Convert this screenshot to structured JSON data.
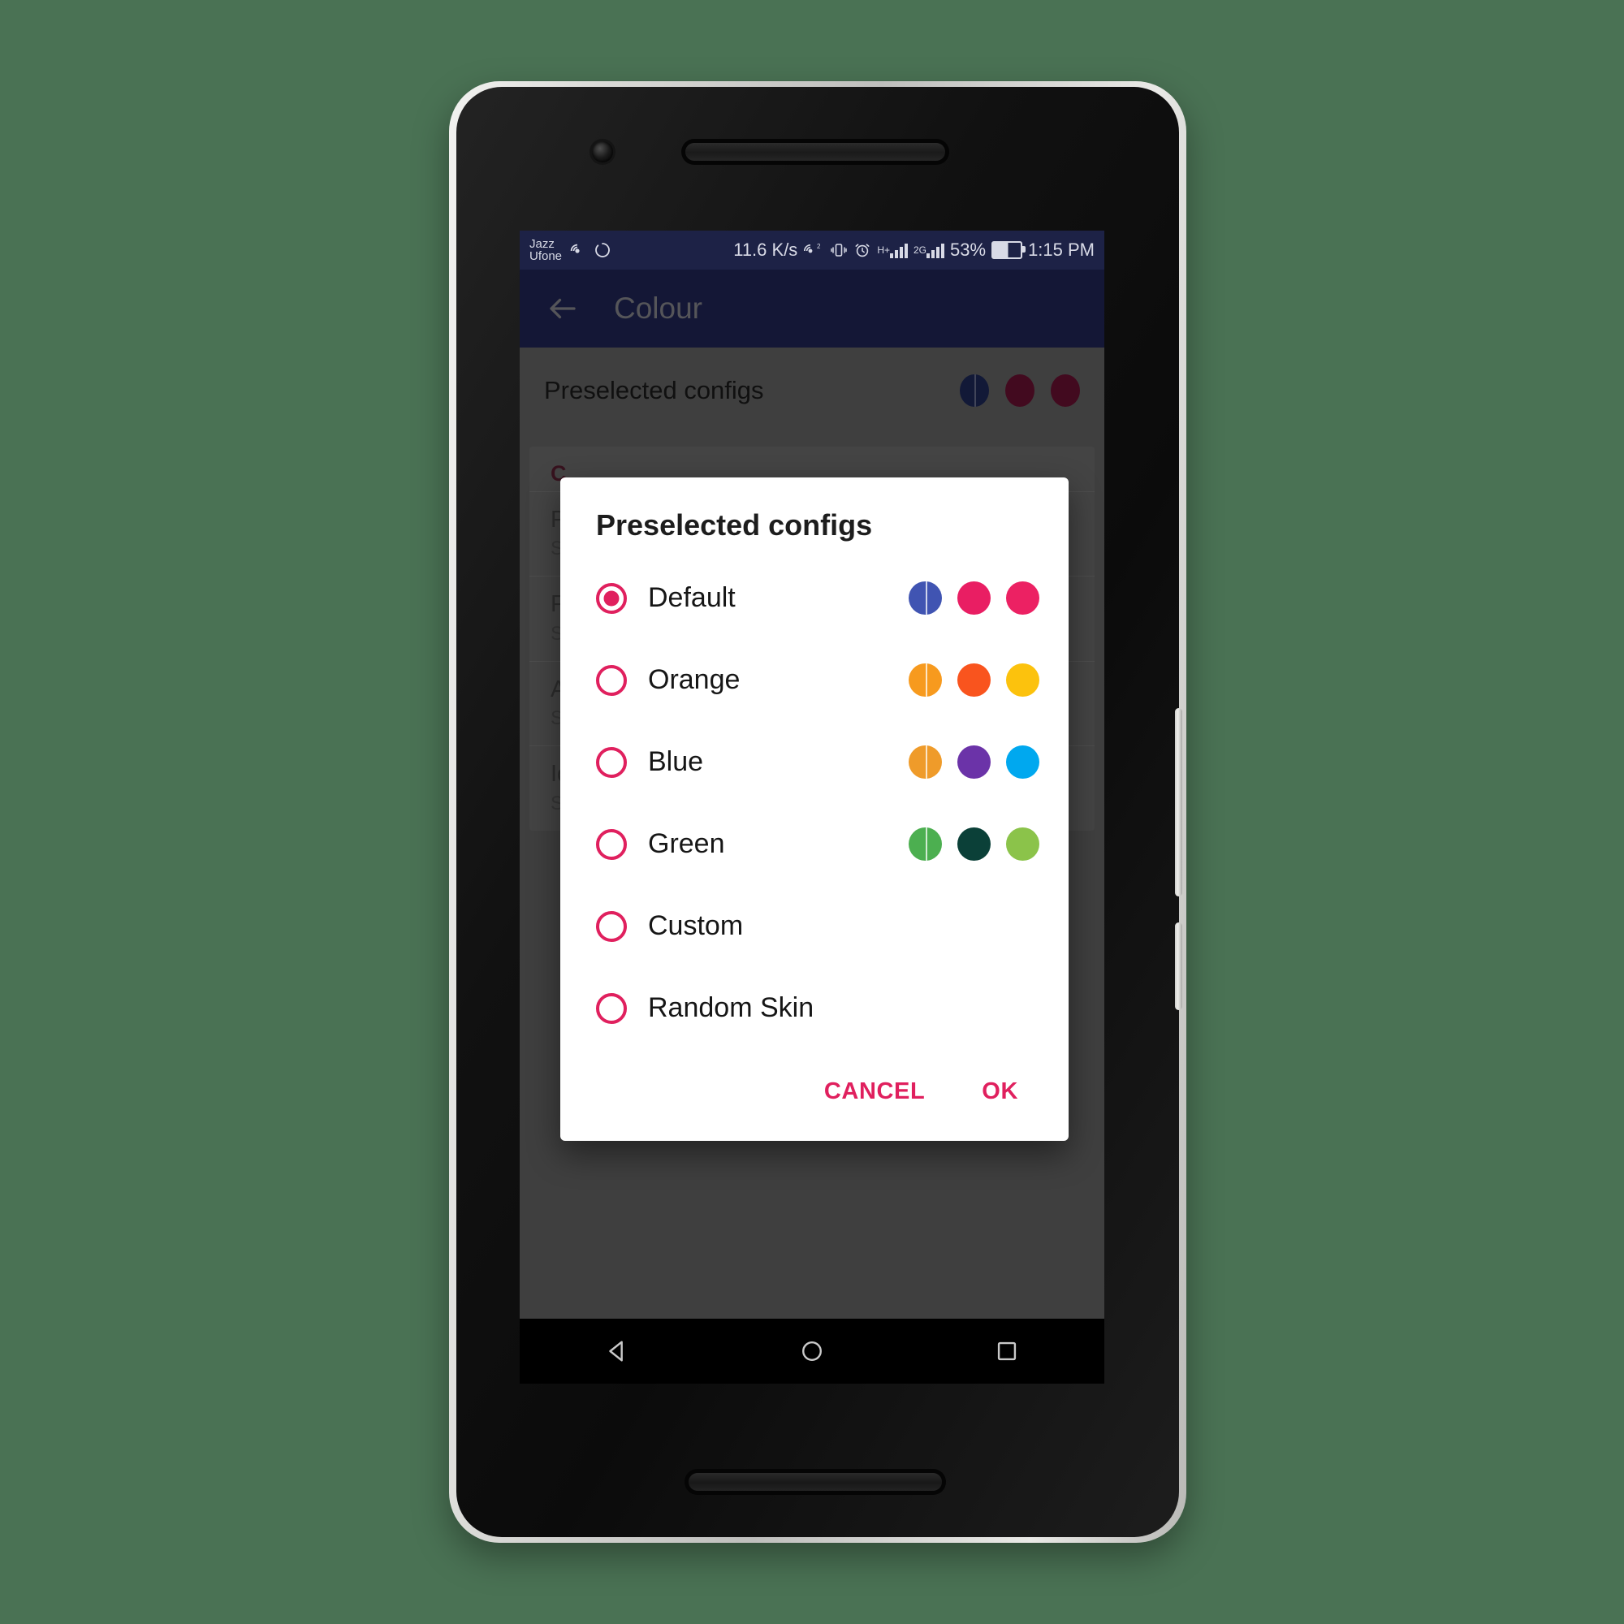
{
  "device": {
    "label": "android-phone",
    "body_color": "#d9d9d6",
    "bezel_color": "#111111"
  },
  "statusbar": {
    "carrier_line1": "Jazz",
    "carrier_line2": "Ufone",
    "net_speed": "11.6 K/s",
    "data_sup": "2",
    "network_1": "H+",
    "network_2": "2G",
    "battery_percent": "53%",
    "clock": "1:15 PM",
    "bg": "#1d2246",
    "fg": "#d8dae6"
  },
  "appbar": {
    "title": "Colour",
    "back_icon": "back-arrow-icon",
    "bg": "#22275a",
    "title_color": "#8e8e94"
  },
  "content": {
    "preselect_row": {
      "label": "Preselected configs",
      "dots": [
        "#1f2a5c",
        "#6e1134",
        "#6e1134"
      ]
    },
    "card_header": "C",
    "list_items": [
      {
        "title": "P",
        "subtitle": "S"
      },
      {
        "title": "P",
        "subtitle": "S"
      },
      {
        "title": "A",
        "subtitle": "S"
      },
      {
        "title": "Id",
        "subtitle": "S"
      }
    ]
  },
  "dialog": {
    "title": "Preselected configs",
    "accent": "#e0205e",
    "options": [
      {
        "label": "Default",
        "selected": true,
        "swatches": [
          "#4054b2",
          "#e91e63",
          "#ec2163"
        ]
      },
      {
        "label": "Orange",
        "selected": false,
        "swatches": [
          "#f79a1e",
          "#f9541e",
          "#fcc20d"
        ]
      },
      {
        "label": "Blue",
        "selected": false,
        "swatches": [
          "#ef9b2a",
          "#6b33a8",
          "#00a8ef"
        ]
      },
      {
        "label": "Green",
        "selected": false,
        "swatches": [
          "#4caf50",
          "#0b4038",
          "#8bc34a"
        ]
      },
      {
        "label": "Custom",
        "selected": false,
        "swatches": []
      },
      {
        "label": "Random Skin",
        "selected": false,
        "swatches": []
      }
    ],
    "cancel_label": "CANCEL",
    "ok_label": "OK"
  },
  "navbar": {
    "back": "nav-back-icon",
    "home": "nav-home-icon",
    "recents": "nav-recents-icon"
  }
}
